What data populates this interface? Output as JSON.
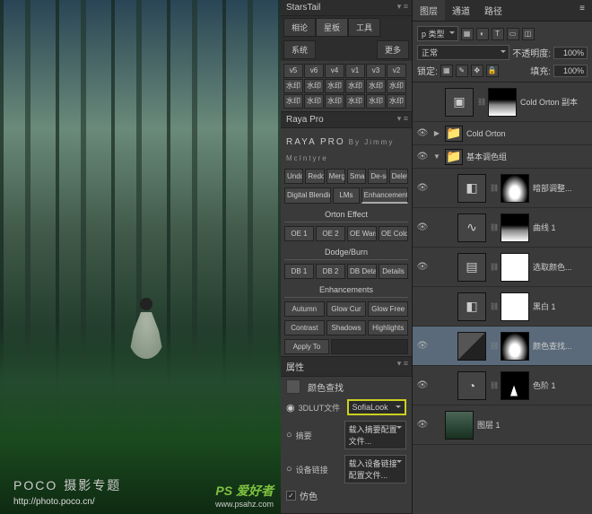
{
  "watermark": {
    "brand": "POCO",
    "brand_sub": "摄影专题",
    "url": "http://photo.poco.cn/",
    "logo": "PS 爱好者",
    "logo_url": "www.psahz.com"
  },
  "starstail": {
    "title": "StarsTail",
    "tabs1": [
      "相论",
      "星板",
      "工具"
    ],
    "tabs2": [
      "系统",
      "更多"
    ],
    "grid": [
      "v5",
      "v6",
      "v4",
      "v1",
      "v3",
      "v2",
      "水印",
      "水印",
      "水印",
      "水印",
      "水印",
      "水印",
      "水印",
      "水印",
      "水印",
      "水印",
      "水印",
      "水印"
    ]
  },
  "raya": {
    "title": "RAYA PRO",
    "author": "By Jimmy McIntyre",
    "row1": [
      "Undo",
      "Redo",
      "Merge",
      "Smart",
      "De-sel",
      "Delete"
    ],
    "row2": [
      "Digital Blending",
      "LMs",
      "Enhancements"
    ],
    "orton_h": "Orton Effect",
    "orton": [
      "OE 1",
      "OE 2",
      "OE Warm",
      "OE Cold"
    ],
    "dodge_h": "Dodge/Burn",
    "dodge": [
      "DB 1",
      "DB 2",
      "DB Details",
      "Details"
    ],
    "enh_h": "Enhancements",
    "enh1": [
      "Autumn",
      "Glow Cur",
      "Glow Free"
    ],
    "enh2": [
      "Contrast",
      "Shadows",
      "Highlights"
    ],
    "apply": "Apply To"
  },
  "props": {
    "panel": "属性",
    "title": "颜色查找",
    "lut_label": "3DLUT文件",
    "lut_value": "SofiaLook",
    "abs_label": "摘要",
    "abs_value": "载入摘要配置文件...",
    "dev_label": "设备链接",
    "dev_value": "载入设备链接配置文件...",
    "dither": "仿色"
  },
  "layers": {
    "tabs": [
      "图层",
      "通道",
      "路径"
    ],
    "kind": "p 类型",
    "blend": "正常",
    "opacity_l": "不透明度:",
    "opacity": "100%",
    "lock_l": "锁定:",
    "fill_l": "填充:",
    "fill": "100%",
    "items": [
      {
        "name": "Cold Orton 副本",
        "mask": "mask-g",
        "adj": "▣",
        "eye": false
      },
      {
        "name": "Cold Orton",
        "group": true,
        "fold": "▶",
        "eye": true
      },
      {
        "name": "基本调色组",
        "group": true,
        "fold": "▼",
        "eye": true
      },
      {
        "name": "暗部调整...",
        "mask": "mask-c",
        "adj": "◧",
        "eye": true,
        "indent": true
      },
      {
        "name": "曲线 1",
        "mask": "mask-g",
        "adj": "∿",
        "eye": true,
        "indent": true
      },
      {
        "name": "选取颜色...",
        "mask": "mask",
        "adj": "▤",
        "eye": true,
        "indent": true
      },
      {
        "name": "黑白 1",
        "mask": "mask",
        "adj": "◧",
        "eye": false,
        "indent": true
      },
      {
        "name": "颜色查找...",
        "mask": "mask-c",
        "adj": "corner",
        "eye": true,
        "indent": true,
        "selected": true
      },
      {
        "name": "色阶 1",
        "mask": "mask-s",
        "adj": "◔",
        "eye": true,
        "indent": true
      },
      {
        "name": "图层 1",
        "img": true,
        "eye": true
      }
    ]
  }
}
